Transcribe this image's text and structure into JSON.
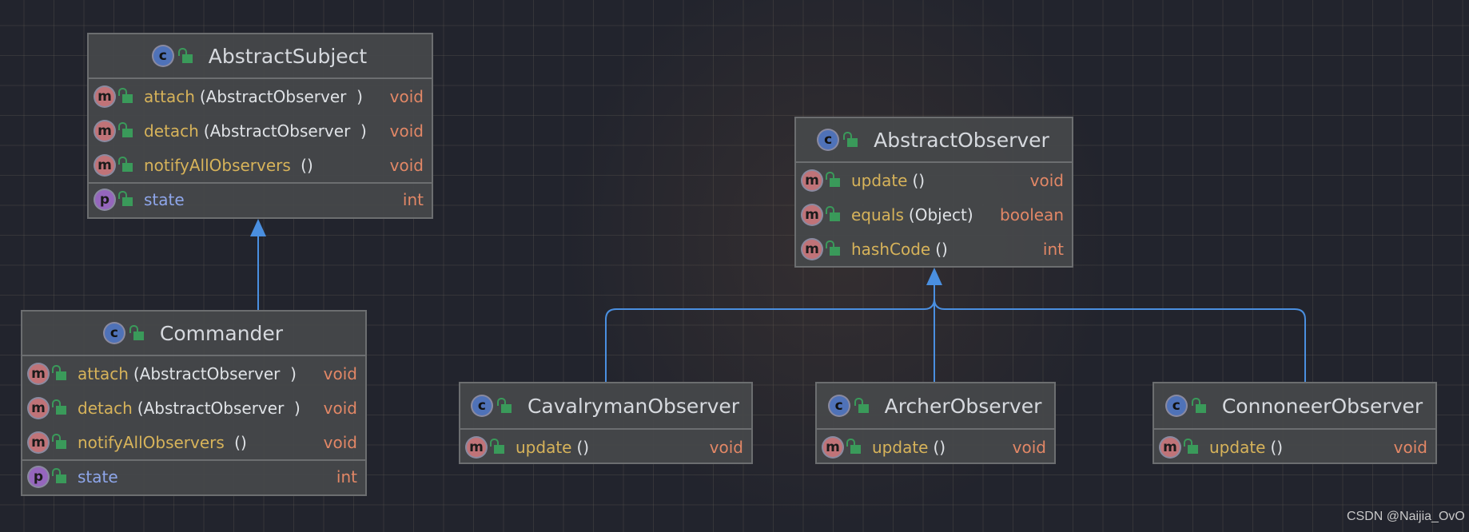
{
  "colors": {
    "class_icon": "#4f72b8",
    "method_icon": "#c07378",
    "property_icon": "#9566bd",
    "visibility_lock": "#3a9a5a",
    "method_name": "#d7b35a",
    "field_name": "#8ea6ea",
    "type": "#e28766",
    "arrow": "#4a8fe0"
  },
  "classes": [
    {
      "id": "abstract-subject",
      "name": "AbstractSubject",
      "members": [
        {
          "kind": "m",
          "name": "attach",
          "params": "(AbstractObserver  )",
          "type": "void"
        },
        {
          "kind": "m",
          "name": "detach",
          "params": "(AbstractObserver  )",
          "type": "void"
        },
        {
          "kind": "m",
          "name": "notifyAllObservers",
          "params": " ()",
          "type": "void"
        },
        {
          "kind": "p",
          "name": "state",
          "params": "",
          "type": "int"
        }
      ]
    },
    {
      "id": "commander",
      "name": "Commander",
      "members": [
        {
          "kind": "m",
          "name": "attach",
          "params": "(AbstractObserver  )",
          "type": "void"
        },
        {
          "kind": "m",
          "name": "detach",
          "params": "(AbstractObserver  )",
          "type": "void"
        },
        {
          "kind": "m",
          "name": "notifyAllObservers",
          "params": " ()",
          "type": "void"
        },
        {
          "kind": "p",
          "name": "state",
          "params": "",
          "type": "int"
        }
      ]
    },
    {
      "id": "abstract-observer",
      "name": "AbstractObserver",
      "members": [
        {
          "kind": "m",
          "name": "update",
          "params": "()",
          "type": "void"
        },
        {
          "kind": "m",
          "name": "equals",
          "params": "(Object)",
          "type": "boolean"
        },
        {
          "kind": "m",
          "name": "hashCode",
          "params": "()",
          "type": "int"
        }
      ]
    },
    {
      "id": "cavalryman-observer",
      "name": "CavalrymanObserver",
      "members": [
        {
          "kind": "m",
          "name": "update",
          "params": "()",
          "type": "void"
        }
      ]
    },
    {
      "id": "archer-observer",
      "name": "ArcherObserver",
      "members": [
        {
          "kind": "m",
          "name": "update",
          "params": "()",
          "type": "void"
        }
      ]
    },
    {
      "id": "connoneer-observer",
      "name": "ConnoneerObserver",
      "members": [
        {
          "kind": "m",
          "name": "update",
          "params": "()",
          "type": "void"
        }
      ]
    }
  ],
  "relations": [
    {
      "from": "Commander",
      "to": "AbstractSubject",
      "type": "extends"
    },
    {
      "from": "CavalrymanObserver",
      "to": "AbstractObserver",
      "type": "extends"
    },
    {
      "from": "ArcherObserver",
      "to": "AbstractObserver",
      "type": "extends"
    },
    {
      "from": "ConnoneerObserver",
      "to": "AbstractObserver",
      "type": "extends"
    }
  ],
  "watermark": "CSDN @Naijia_OvO"
}
